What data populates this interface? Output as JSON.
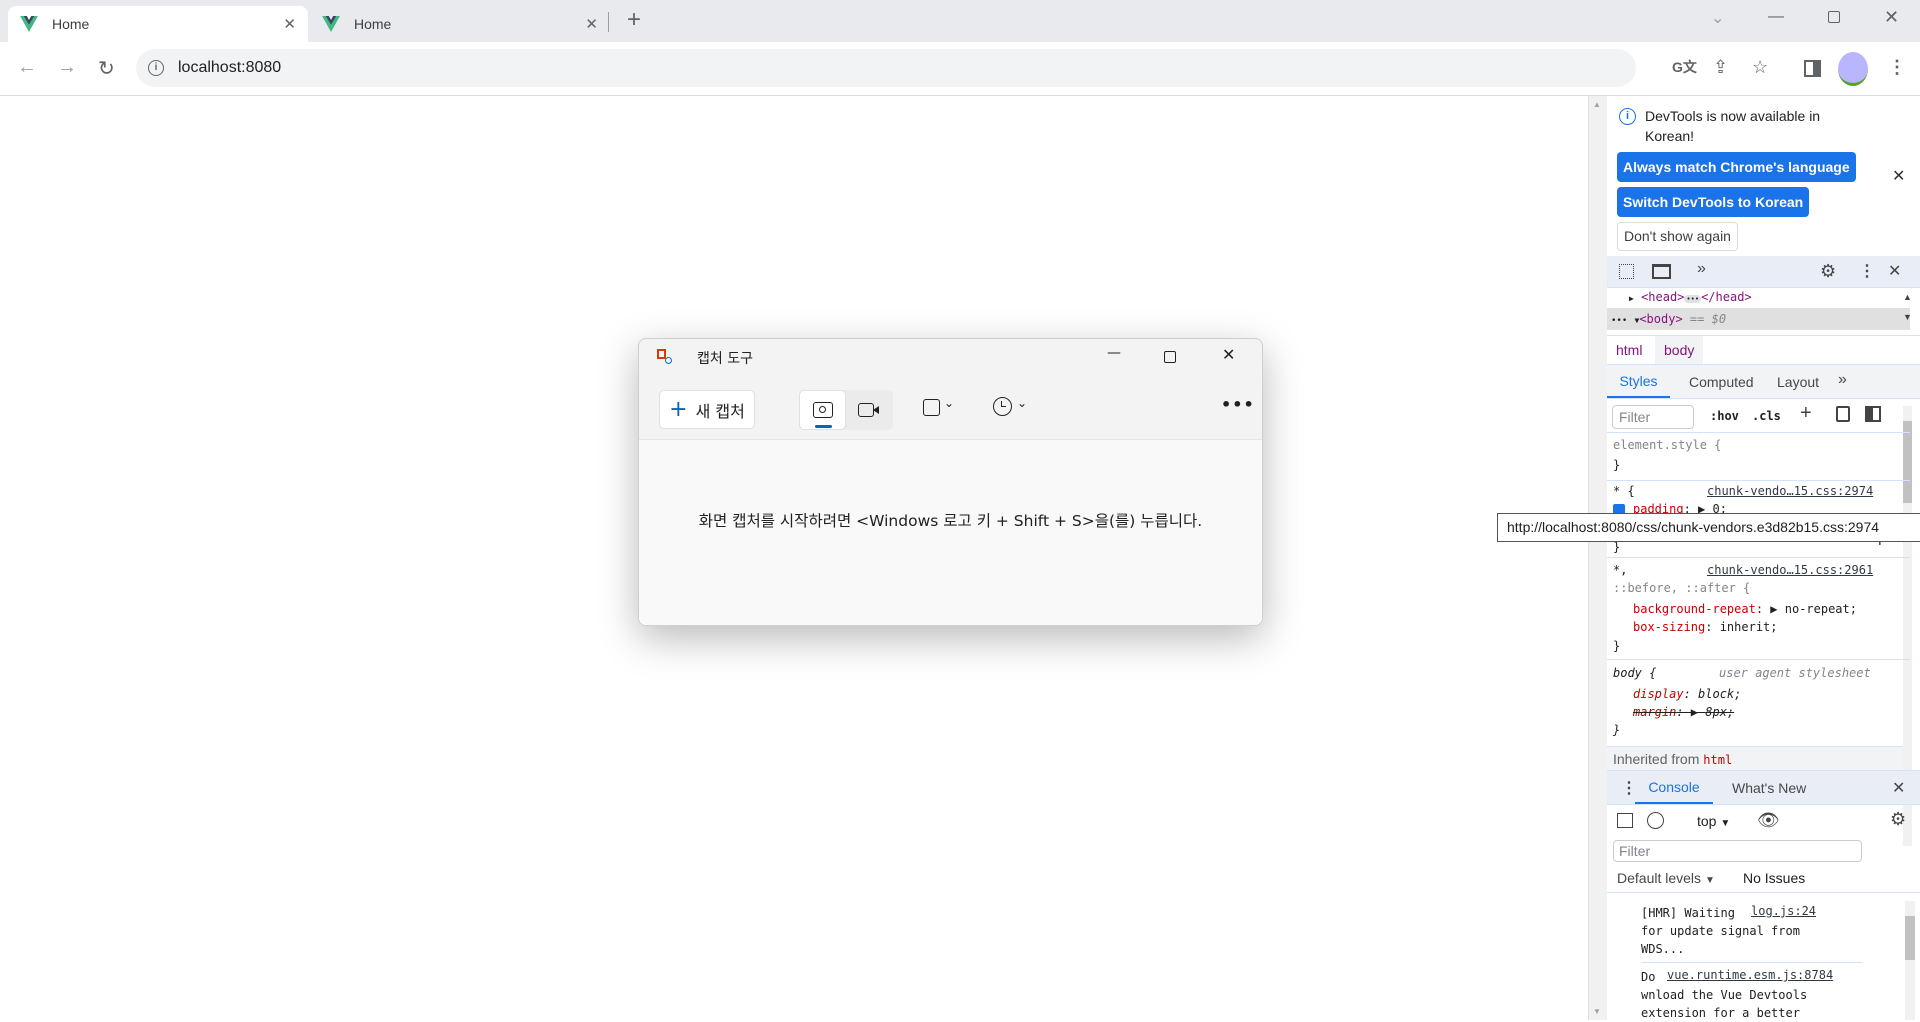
{
  "browser": {
    "tabs": [
      {
        "title": "Home",
        "active": true
      },
      {
        "title": "Home",
        "active": false
      }
    ],
    "new_tab": "+",
    "url": "localhost:8080",
    "window_controls": [
      "chevron-down",
      "minimize",
      "restore",
      "close"
    ]
  },
  "snipping_tool": {
    "title": "캡처 도구",
    "new_capture": "새 캡처",
    "more": "•••",
    "message": "화면 캡처를 시작하려면 <Windows 로고 키 + Shift + S>을(를) 누릅니다."
  },
  "devtools": {
    "banner": {
      "text": "DevTools is now available in Korean!",
      "btn_match": "Always match Chrome's language",
      "btn_switch": "Switch DevTools to Korean",
      "btn_dont_show": "Don't show again"
    },
    "elements": {
      "head_open": "<head>",
      "ellipsis": "•••",
      "head_close": "</head>",
      "body_tag": "<body>",
      "body_eq": "== $0"
    },
    "breadcrumb": [
      "html",
      "body"
    ],
    "tabs": [
      "Styles",
      "Computed",
      "Layout"
    ],
    "more_tabs": "»",
    "styles": {
      "filter_placeholder": "Filter",
      "hov": ":hov",
      "cls": ".cls",
      "element_style": "element.style {",
      "close_brace": "}",
      "rule1_selector": "* {",
      "rule1_source": "chunk-vendo…15.css:2974",
      "rule1_prop": "padding",
      "rule1_val": "0;",
      "tooltip": "http://localhost:8080/css/chunk-vendors.e3d82b15.css:2974",
      "rule2_selector1": "*,",
      "rule2_selector2": "::before, ::after {",
      "rule2_source": "chunk-vendo…15.css:2961",
      "rule2_p1": "background-repeat",
      "rule2_v1": "no-repeat;",
      "rule2_p2": "box-sizing",
      "rule2_v2": "inherit;",
      "rule3_selector": "body {",
      "rule3_source": "user agent stylesheet",
      "rule3_p1": "display",
      "rule3_v1": "block;",
      "rule3_p2": "margin",
      "rule3_v2": "8px;",
      "inherited_label": "Inherited from",
      "inherited_tag": "html"
    },
    "drawer": {
      "tabs": [
        "Console",
        "What's New"
      ],
      "context": "top",
      "filter_placeholder": "Filter",
      "levels": "Default levels",
      "issues": "No Issues",
      "logs": [
        {
          "text_lines": [
            "[HMR] Waiting",
            "for update signal from",
            "WDS..."
          ],
          "source": "log.js:24"
        },
        {
          "text_lines": [
            "Do",
            "wnload the Vue Devtools",
            "extension for a better"
          ],
          "source": "vue.runtime.esm.js:8784"
        }
      ]
    }
  }
}
